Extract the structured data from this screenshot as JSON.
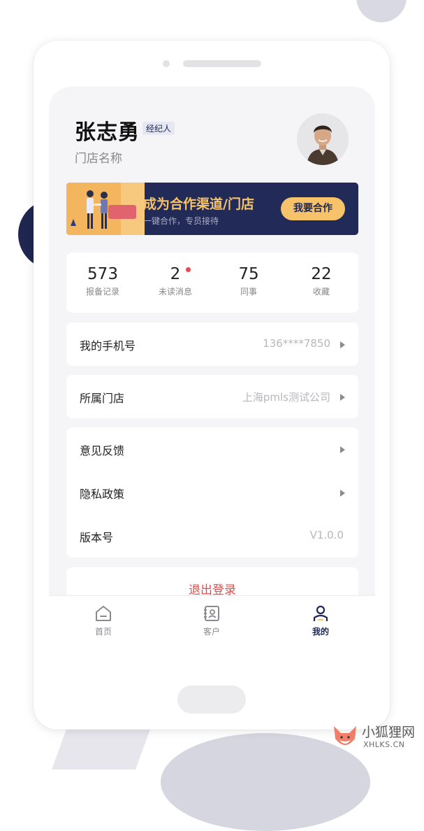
{
  "profile": {
    "name": "张志勇",
    "role_badge": "经纪人",
    "store": "门店名称"
  },
  "banner": {
    "title": "成为合作渠道/门店",
    "subtitle": "一键合作，专员接待",
    "button": "我要合作"
  },
  "stats": [
    {
      "value": "573",
      "label": "报备记录"
    },
    {
      "value": "2",
      "label": "未读消息",
      "has_dot": true
    },
    {
      "value": "75",
      "label": "同事"
    },
    {
      "value": "22",
      "label": "收藏"
    }
  ],
  "menu": {
    "phone": {
      "label": "我的手机号",
      "value": "136****7850"
    },
    "store": {
      "label": "所属门店",
      "value": "上海pmls测试公司"
    },
    "feedback": {
      "label": "意见反馈"
    },
    "privacy": {
      "label": "隐私政策"
    },
    "version": {
      "label": "版本号",
      "value": "V1.0.0"
    }
  },
  "logout": "退出登录",
  "tabs": [
    {
      "label": "首页",
      "icon": "home-icon",
      "active": false
    },
    {
      "label": "客户",
      "icon": "contacts-icon",
      "active": false
    },
    {
      "label": "我的",
      "icon": "person-icon",
      "active": true
    }
  ],
  "colors": {
    "brand_navy": "#1f2650",
    "accent_gold": "#f6c36a",
    "danger_red": "#e84a4a",
    "background": "#f5f5f7"
  },
  "watermark": {
    "cn": "小狐狸网",
    "en": "XHLKS.CN"
  }
}
